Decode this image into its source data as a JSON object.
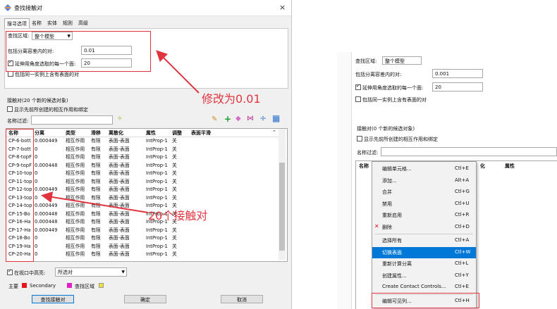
{
  "dialog": {
    "title": "查找接触对",
    "close": "×",
    "tabs": [
      "搜寻选项",
      "名称",
      "实体",
      "规则",
      "高级"
    ],
    "search_domain_label": "查找区域:",
    "search_domain_value": "整个模型",
    "separation_tolerance_label": "包括分离容差内的对:",
    "separation_tolerance_value": "0.01",
    "extend_angle_label": "延伸用角度选取的每一个面:",
    "extend_angle_value": "20",
    "same_instance_label": "包括同一实例上含有表面的对",
    "pairs_group_label": "接触对(20 个新的候选对象)",
    "show_previous_label": "显示先前所创建的相互作用和绑定",
    "name_filter_label": "名称过滤:",
    "name_filter_value": "",
    "columns": [
      "名称",
      "分离",
      "类型",
      "滑移",
      "离散化",
      "属性",
      "调整",
      "表面平滑"
    ],
    "rows": [
      [
        "CP-6-bott",
        "0.000449",
        "相互作用",
        "有限",
        "表面-表面",
        "IntProp-1",
        "关",
        ""
      ],
      [
        "CP-7-bott",
        "0",
        "相互作用",
        "有限",
        "表面-表面",
        "IntProp-1",
        "关",
        ""
      ],
      [
        "CP-8-topF",
        "0",
        "相互作用",
        "有限",
        "表面-表面",
        "IntProp-1",
        "关",
        ""
      ],
      [
        "CP-9-topF",
        "0.000448",
        "相互作用",
        "有限",
        "表面-表面",
        "IntProp-1",
        "关",
        ""
      ],
      [
        "CP-10-top",
        "0",
        "相互作用",
        "有限",
        "表面-表面",
        "IntProp-1",
        "关",
        ""
      ],
      [
        "CP-11-top",
        "0",
        "相互作用",
        "有限",
        "表面-表面",
        "IntProp-1",
        "关",
        ""
      ],
      [
        "CP-12-top",
        "0.000449",
        "相互作用",
        "有限",
        "表面-表面",
        "IntProp-1",
        "关",
        ""
      ],
      [
        "CP-13-top",
        "0",
        "相互作用",
        "有限",
        "表面-表面",
        "IntProp-1",
        "关",
        ""
      ],
      [
        "CP-14-top",
        "0.000449",
        "相互作用",
        "有限",
        "表面-表面",
        "IntProp-1",
        "关",
        ""
      ],
      [
        "CP-15-Bo",
        "0.000448",
        "相互作用",
        "有限",
        "表面-表面",
        "IntProp-1",
        "关",
        ""
      ],
      [
        "CP-16-Ha",
        "0.000448",
        "相互作用",
        "有限",
        "表面-表面",
        "IntProp-1",
        "关",
        ""
      ],
      [
        "CP-17-Ha",
        "0.000449",
        "相互作用",
        "有限",
        "表面-表面",
        "IntProp-1",
        "关",
        ""
      ],
      [
        "CP-18-Bo",
        "0",
        "相互作用",
        "有限",
        "表面-表面",
        "IntProp-1",
        "关",
        ""
      ],
      [
        "CP-19-Ha",
        "0",
        "相互作用",
        "有限",
        "表面-表面",
        "IntProp-1",
        "关",
        ""
      ],
      [
        "CP-20-Ha",
        "0",
        "相互作用",
        "有限",
        "表面-表面",
        "IntProp-1",
        "关",
        ""
      ]
    ],
    "highlight_label": "在视口中高亮:",
    "highlight_value": "所选对",
    "legend": {
      "main": "主要",
      "secondary": "Secondary",
      "search_domain": "查找区域"
    },
    "buttons": {
      "find": "查找接触对",
      "ok": "确定",
      "cancel": "取消"
    },
    "colors": {
      "main": "#e8141c",
      "secondary": "#e020c0",
      "search_domain": "#f0e030",
      "annotation": "#e0353f",
      "accent": "#0078d7"
    }
  },
  "annotations": {
    "modify": "修改为0.01",
    "pairs": "20个接触对"
  },
  "right": {
    "search_domain_label": "查找区域:",
    "search_domain_value": "整个模型",
    "separation_tolerance_label": "包括分离容差内的对:",
    "separation_tolerance_value": "0.001",
    "extend_angle_label": "延伸用角度选取的每一个面:",
    "extend_angle_value": "20",
    "same_instance_label": "包括同一实例上含有表面的对",
    "pairs_group_label": "接触对(0 个新的候选对象)",
    "show_previous_label": "显示先前所创建的相互作用和绑定",
    "name_filter_label": "名称过滤:",
    "columns": [
      "名称",
      "化",
      "属性"
    ],
    "menu": [
      {
        "label": "编辑单元格...",
        "shortcut": "Ctl+E"
      },
      {
        "label": "添加...",
        "shortcut": "Alt+A"
      },
      {
        "label": "合并",
        "shortcut": "Ctl+G"
      },
      {
        "label": "禁用",
        "shortcut": "Ctl+U"
      },
      {
        "label": "重新启用",
        "shortcut": "Ctl+R"
      },
      {
        "label": "删除",
        "shortcut": "Ctl+D"
      },
      {
        "label": "选择所有",
        "shortcut": "Ctl+A"
      },
      {
        "label": "切换表面",
        "shortcut": "Ctl+W"
      },
      {
        "label": "重新计算分离",
        "shortcut": "Ctl+L"
      },
      {
        "label": "创建属性...",
        "shortcut": "Ctl+Y"
      },
      {
        "label": "Create Contact Controls...",
        "shortcut": "Ctl+E"
      },
      {
        "label": "编辑可见列...",
        "shortcut": "Ctl+H"
      }
    ]
  }
}
